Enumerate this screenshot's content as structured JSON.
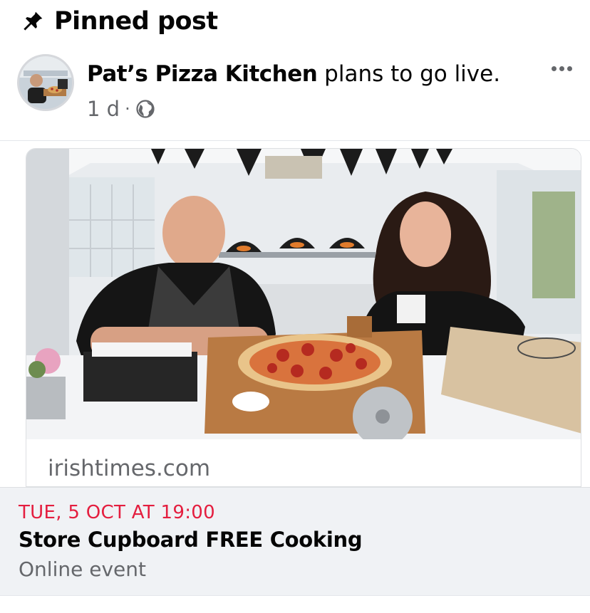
{
  "pinned": {
    "label": "Pinned post",
    "icon": "pin-icon"
  },
  "post": {
    "author": "Pat’s Pizza Kitchen",
    "action": "plans to go live.",
    "time": "1 d",
    "separator": "·",
    "privacy_icon": "globe-icon",
    "more_icon": "more-options-icon"
  },
  "link_preview": {
    "domain": "irishtimes.com",
    "image_alt": "Photo of two people smiling behind a pizza on a wooden board with pizza ovens in the background"
  },
  "event": {
    "date": "TUE, 5 OCT AT 19:00",
    "title": "Store Cupboard FREE Cooking",
    "subtitle": "Online event"
  },
  "colors": {
    "accent_red": "#e41e3f",
    "muted_text": "#65676b",
    "event_bg": "#f0f2f5"
  }
}
